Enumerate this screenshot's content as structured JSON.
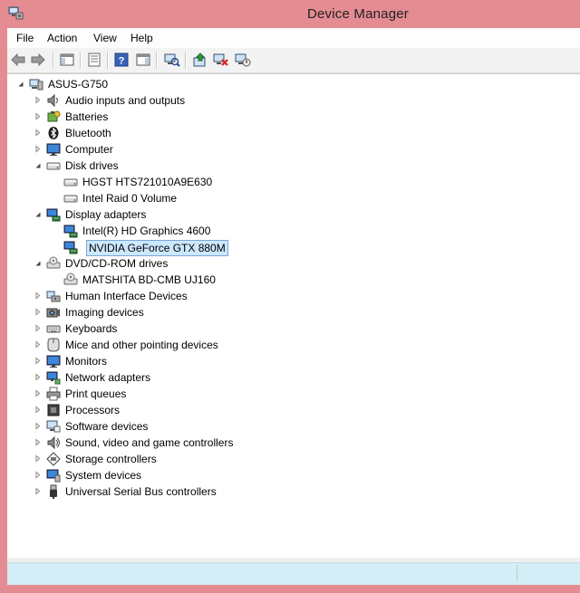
{
  "window": {
    "title": "Device Manager",
    "frame_color": "#e48c92"
  },
  "menu": [
    "File",
    "Action",
    "View",
    "Help"
  ],
  "toolbar": {
    "buttons": [
      "back-icon",
      "forward-icon",
      "show-hide-console-tree-icon",
      "properties-icon",
      "help-icon",
      "action-pane-icon",
      "scan-hardware-icon",
      "update-driver-icon",
      "uninstall-icon",
      "enable-device-icon"
    ]
  },
  "tree": {
    "root": "ASUS-G750",
    "categories": [
      "Audio inputs and outputs",
      "Batteries",
      "Bluetooth",
      "Computer",
      "Disk drives",
      "HGST HTS721010A9E630",
      "Intel Raid 0 Volume",
      "Display adapters",
      "Intel(R) HD Graphics 4600",
      "NVIDIA GeForce GTX 880M",
      "DVD/CD-ROM drives",
      "MATSHITA BD-CMB UJ160",
      "Human Interface Devices",
      "Imaging devices",
      "Keyboards",
      "Mice and other pointing devices",
      "Monitors",
      "Network adapters",
      "Print queues",
      "Processors",
      "Software devices",
      "Sound, video and game controllers",
      "Storage controllers",
      "System devices",
      "Universal Serial Bus controllers"
    ],
    "selected": "NVIDIA GeForce GTX 880M"
  },
  "colors": {
    "selection_bg": "#cce8ff",
    "statusbar_bg": "#d3eef6"
  }
}
